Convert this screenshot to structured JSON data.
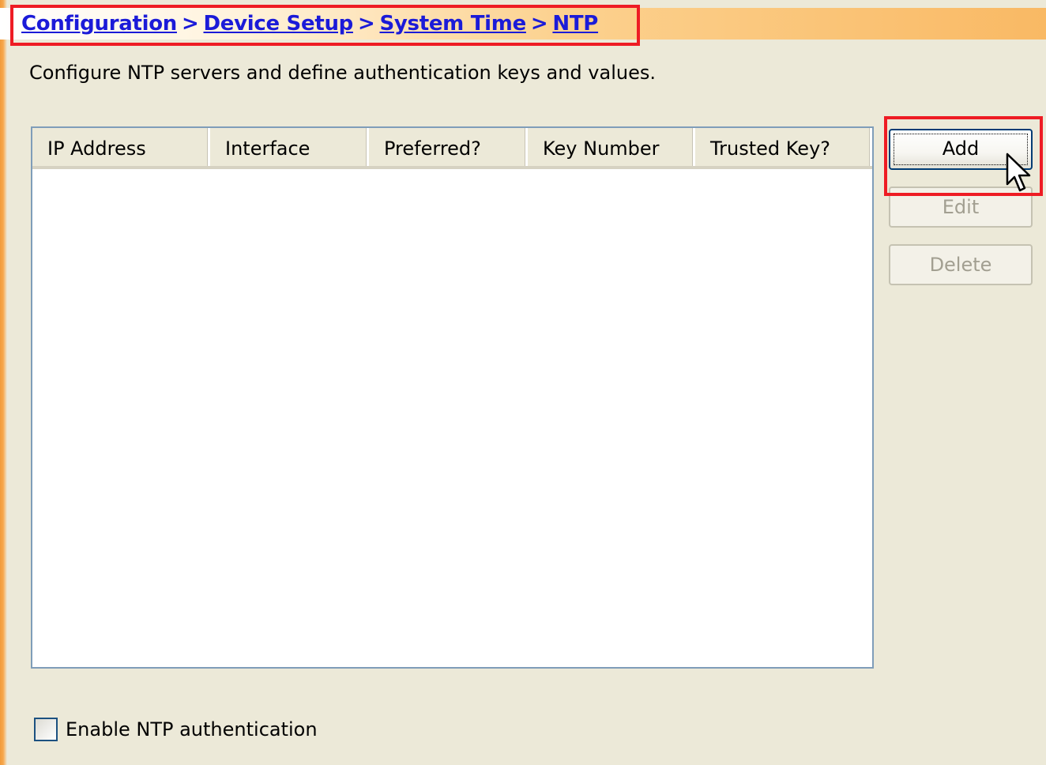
{
  "breadcrumb": {
    "items": [
      "Configuration",
      "Device Setup",
      "System Time",
      "NTP"
    ],
    "separator": ">"
  },
  "description": "Configure NTP servers and define authentication keys and values.",
  "table": {
    "columns": [
      "IP Address",
      "Interface",
      "Preferred?",
      "Key Number",
      "Trusted Key?"
    ],
    "rows": []
  },
  "buttons": {
    "add": "Add",
    "edit": "Edit",
    "delete": "Delete"
  },
  "authentication": {
    "label": "Enable NTP authentication",
    "checked": false
  },
  "colors": {
    "link": "#1b1bd8",
    "highlight": "#ee1c24",
    "panel_bg": "#ece9d8",
    "accent_orange": "#f29a3a"
  }
}
